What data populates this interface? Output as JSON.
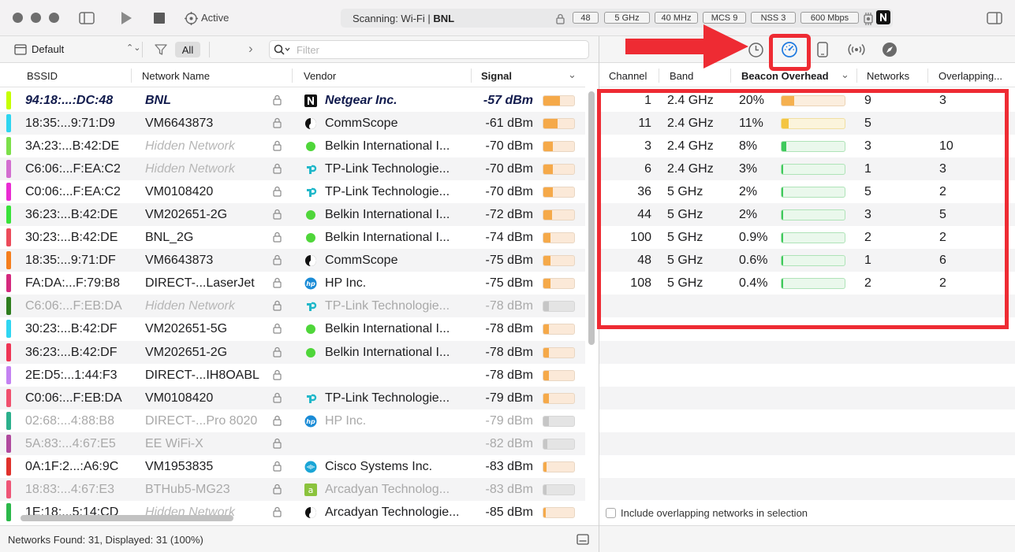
{
  "titlebar": {
    "state_label": "Active",
    "scan_prefix": "Scanning: Wi-Fi  |",
    "scan_network": "BNL",
    "badges": [
      "48",
      "5 GHz",
      "40 MHz",
      "MCS 9",
      "NSS 3",
      "600 Mbps"
    ]
  },
  "left_toolbar": {
    "profile": "Default",
    "filter_all": "All",
    "filter_placeholder": "Filter"
  },
  "left_columns": [
    "BSSID",
    "Network Name",
    "Vendor",
    "Signal"
  ],
  "rows": [
    {
      "bssid": "94:18:...:DC:48",
      "name": "BNL",
      "vendor": "Netgear Inc.",
      "vicon": "netgear-icon",
      "signal": "-57 dBm",
      "level": 0.55,
      "color": "#c6ff00",
      "selected": true
    },
    {
      "bssid": "18:35:...9:71:D9",
      "name": "VM6643873",
      "vendor": "CommScope",
      "vicon": "commscope-icon",
      "signal": "-61 dBm",
      "level": 0.45,
      "color": "#2ed5f0"
    },
    {
      "bssid": "3A:23:...B:42:DE",
      "name": "Hidden Network",
      "hidden": true,
      "vendor": "Belkin International I...",
      "vicon": "belkin-icon",
      "signal": "-70 dBm",
      "level": 0.3,
      "color": "#7ce04a"
    },
    {
      "bssid": "C6:06:...F:EA:C2",
      "name": "Hidden Network",
      "hidden": true,
      "vendor": "TP-Link Technologie...",
      "vicon": "tplink-icon",
      "signal": "-70 dBm",
      "level": 0.3,
      "color": "#d36ed0"
    },
    {
      "bssid": "C0:06:...F:EA:C2",
      "name": "VM0108420",
      "vendor": "TP-Link Technologie...",
      "vicon": "tplink-icon",
      "signal": "-70 dBm",
      "level": 0.3,
      "color": "#ea2bd3"
    },
    {
      "bssid": "36:23:...B:42:DE",
      "name": "VM202651-2G",
      "vendor": "Belkin International I...",
      "vicon": "belkin-icon",
      "signal": "-72 dBm",
      "level": 0.27,
      "color": "#39e23a"
    },
    {
      "bssid": "30:23:...B:42:DE",
      "name": "BNL_2G",
      "vendor": "Belkin International I...",
      "vicon": "belkin-icon",
      "signal": "-74 dBm",
      "level": 0.24,
      "color": "#ec4b5a"
    },
    {
      "bssid": "18:35:...9:71:DF",
      "name": "VM6643873",
      "vendor": "CommScope",
      "vicon": "commscope-icon",
      "signal": "-75 dBm",
      "level": 0.23,
      "color": "#f57e1d"
    },
    {
      "bssid": "FA:DA:...F:79:B8",
      "name": "DIRECT-...LaserJet",
      "vendor": "HP Inc.",
      "vicon": "hp-icon",
      "signal": "-75 dBm",
      "level": 0.23,
      "color": "#d4297e"
    },
    {
      "bssid": "C6:06:...F:EB:DA",
      "name": "Hidden Network",
      "hidden": true,
      "vendor": "TP-Link Technologie...",
      "vicon": "tplink-icon",
      "signal": "-78 dBm",
      "level": 0.18,
      "color": "#2e7d1e",
      "dim": true
    },
    {
      "bssid": "30:23:...B:42:DF",
      "name": "VM202651-5G",
      "vendor": "Belkin International I...",
      "vicon": "belkin-icon",
      "signal": "-78 dBm",
      "level": 0.18,
      "color": "#2fd6f2"
    },
    {
      "bssid": "36:23:...B:42:DF",
      "name": "VM202651-2G",
      "vendor": "Belkin International I...",
      "vicon": "belkin-icon",
      "signal": "-78 dBm",
      "level": 0.18,
      "color": "#ef3555"
    },
    {
      "bssid": "2E:D5:...1:44:F3",
      "name": "DIRECT-...IH8OABL",
      "vendor": "",
      "vicon": "",
      "signal": "-78 dBm",
      "level": 0.18,
      "color": "#c482f2"
    },
    {
      "bssid": "C0:06:...F:EB:DA",
      "name": "VM0108420",
      "vendor": "TP-Link Technologie...",
      "vicon": "tplink-icon",
      "signal": "-79 dBm",
      "level": 0.17,
      "color": "#f0506e"
    },
    {
      "bssid": "02:68:...4:88:B8",
      "name": "DIRECT-...Pro 8020",
      "vendor": "HP Inc.",
      "vicon": "hp-icon",
      "signal": "-79 dBm",
      "level": 0.17,
      "color": "#2bb08c",
      "dim": true
    },
    {
      "bssid": "5A:83:...4:67:E5",
      "name": "EE WiFi-X",
      "vendor": "",
      "vicon": "",
      "signal": "-82 dBm",
      "level": 0.12,
      "color": "#b04a9e",
      "dim": true
    },
    {
      "bssid": "0A:1F:2...:A6:9C",
      "name": "VM1953835",
      "vendor": "Cisco Systems Inc.",
      "vicon": "cisco-icon",
      "signal": "-83 dBm",
      "level": 0.11,
      "color": "#e0312b"
    },
    {
      "bssid": "18:83:...4:67:E3",
      "name": "BTHub5-MG23",
      "vendor": "Arcadyan Technolog...",
      "vicon": "arcadyan-icon",
      "signal": "-83 dBm",
      "level": 0.11,
      "color": "#ee5577",
      "dim": true
    },
    {
      "bssid": "1E:18:...5:14:CD",
      "name": "Hidden Network",
      "hidden": true,
      "vendor": "Arcadyan Technologie...",
      "vicon": "commscope-icon",
      "signal": "-85 dBm",
      "level": 0.08,
      "color": "#2bb84a"
    }
  ],
  "status": {
    "text": "Networks Found: 31, Displayed: 31 (100%)"
  },
  "right_columns": [
    "Channel",
    "Band",
    "Beacon Overhead",
    "Networks",
    "Overlapping..."
  ],
  "channels": [
    {
      "channel": "1",
      "band": "2.4 GHz",
      "overhead": "20%",
      "fraction": 0.2,
      "networks": "9",
      "overlapping": "3",
      "style": "warn"
    },
    {
      "channel": "11",
      "band": "2.4 GHz",
      "overhead": "11%",
      "fraction": 0.11,
      "networks": "5",
      "overlapping": "",
      "style": "mid"
    },
    {
      "channel": "3",
      "band": "2.4 GHz",
      "overhead": "8%",
      "fraction": 0.08,
      "networks": "3",
      "overlapping": "10",
      "style": "ok"
    },
    {
      "channel": "6",
      "band": "2.4 GHz",
      "overhead": "3%",
      "fraction": 0.03,
      "networks": "1",
      "overlapping": "3",
      "style": "ok"
    },
    {
      "channel": "36",
      "band": "5 GHz",
      "overhead": "2%",
      "fraction": 0.02,
      "networks": "5",
      "overlapping": "2",
      "style": "ok"
    },
    {
      "channel": "44",
      "band": "5 GHz",
      "overhead": "2%",
      "fraction": 0.02,
      "networks": "3",
      "overlapping": "5",
      "style": "ok"
    },
    {
      "channel": "100",
      "band": "5 GHz",
      "overhead": "0.9%",
      "fraction": 0.009,
      "networks": "2",
      "overlapping": "2",
      "style": "ok"
    },
    {
      "channel": "48",
      "band": "5 GHz",
      "overhead": "0.6%",
      "fraction": 0.006,
      "networks": "1",
      "overlapping": "6",
      "style": "ok"
    },
    {
      "channel": "108",
      "band": "5 GHz",
      "overhead": "0.4%",
      "fraction": 0.004,
      "networks": "2",
      "overlapping": "2",
      "style": "ok"
    }
  ],
  "right_footer": {
    "checkbox_label": "Include overlapping networks in selection"
  },
  "colors": {
    "accent": "#1f7ae0",
    "annotation": "#ee2b33"
  }
}
